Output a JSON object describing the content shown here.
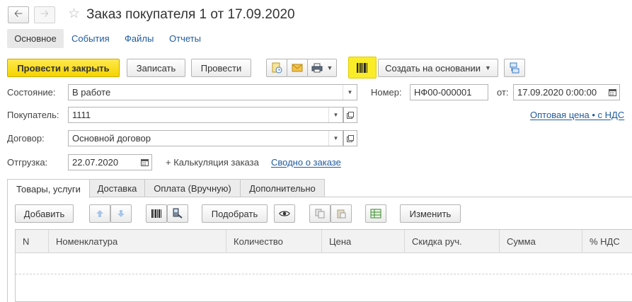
{
  "window": {
    "title": "Заказ покупателя 1 от 17.09.2020",
    "back_icon": "arrow-left-icon",
    "forward_icon": "arrow-right-icon",
    "favorite_icon": "star-icon"
  },
  "nav": {
    "tabs": [
      {
        "label": "Основное",
        "active": true
      },
      {
        "label": "События"
      },
      {
        "label": "Файлы"
      },
      {
        "label": "Отчеты"
      }
    ]
  },
  "toolbar": {
    "post_close": "Провести и закрыть",
    "save": "Записать",
    "post": "Провести",
    "create_based": "Создать на основании",
    "icons": [
      "document-history-icon",
      "envelope-icon",
      "printer-icon",
      "barcode-icon",
      "structure-icon"
    ]
  },
  "form": {
    "state_label": "Состояние:",
    "state_value": "В работе",
    "number_label": "Номер:",
    "number_value": "НФ00-000001",
    "date_label": "от:",
    "date_value": "17.09.2020  0:00:00",
    "price_link": "Оптовая цена • с НДС",
    "buyer_label": "Покупатель:",
    "buyer_value": "1111",
    "contract_label": "Договор:",
    "contract_value": "Основной договор",
    "shipment_label": "Отгрузка:",
    "shipment_value": "22.07.2020",
    "calc_label": "+ Калькуляция заказа",
    "summary_link": "Сводно о заказе"
  },
  "tabs": [
    {
      "label": "Товары, услуги",
      "active": true
    },
    {
      "label": "Доставка"
    },
    {
      "label": "Оплата (Вручную)"
    },
    {
      "label": "Дополнительно"
    }
  ],
  "table_toolbar": {
    "add": "Добавить",
    "pick": "Подобрать",
    "change": "Изменить"
  },
  "table": {
    "columns": [
      "N",
      "Номенклатура",
      "Количество",
      "Цена",
      "Скидка руч.",
      "Сумма",
      "% НДС"
    ],
    "rows": []
  },
  "colors": {
    "accent_yellow": "#f5d400",
    "link_blue": "#1f5a9e"
  }
}
